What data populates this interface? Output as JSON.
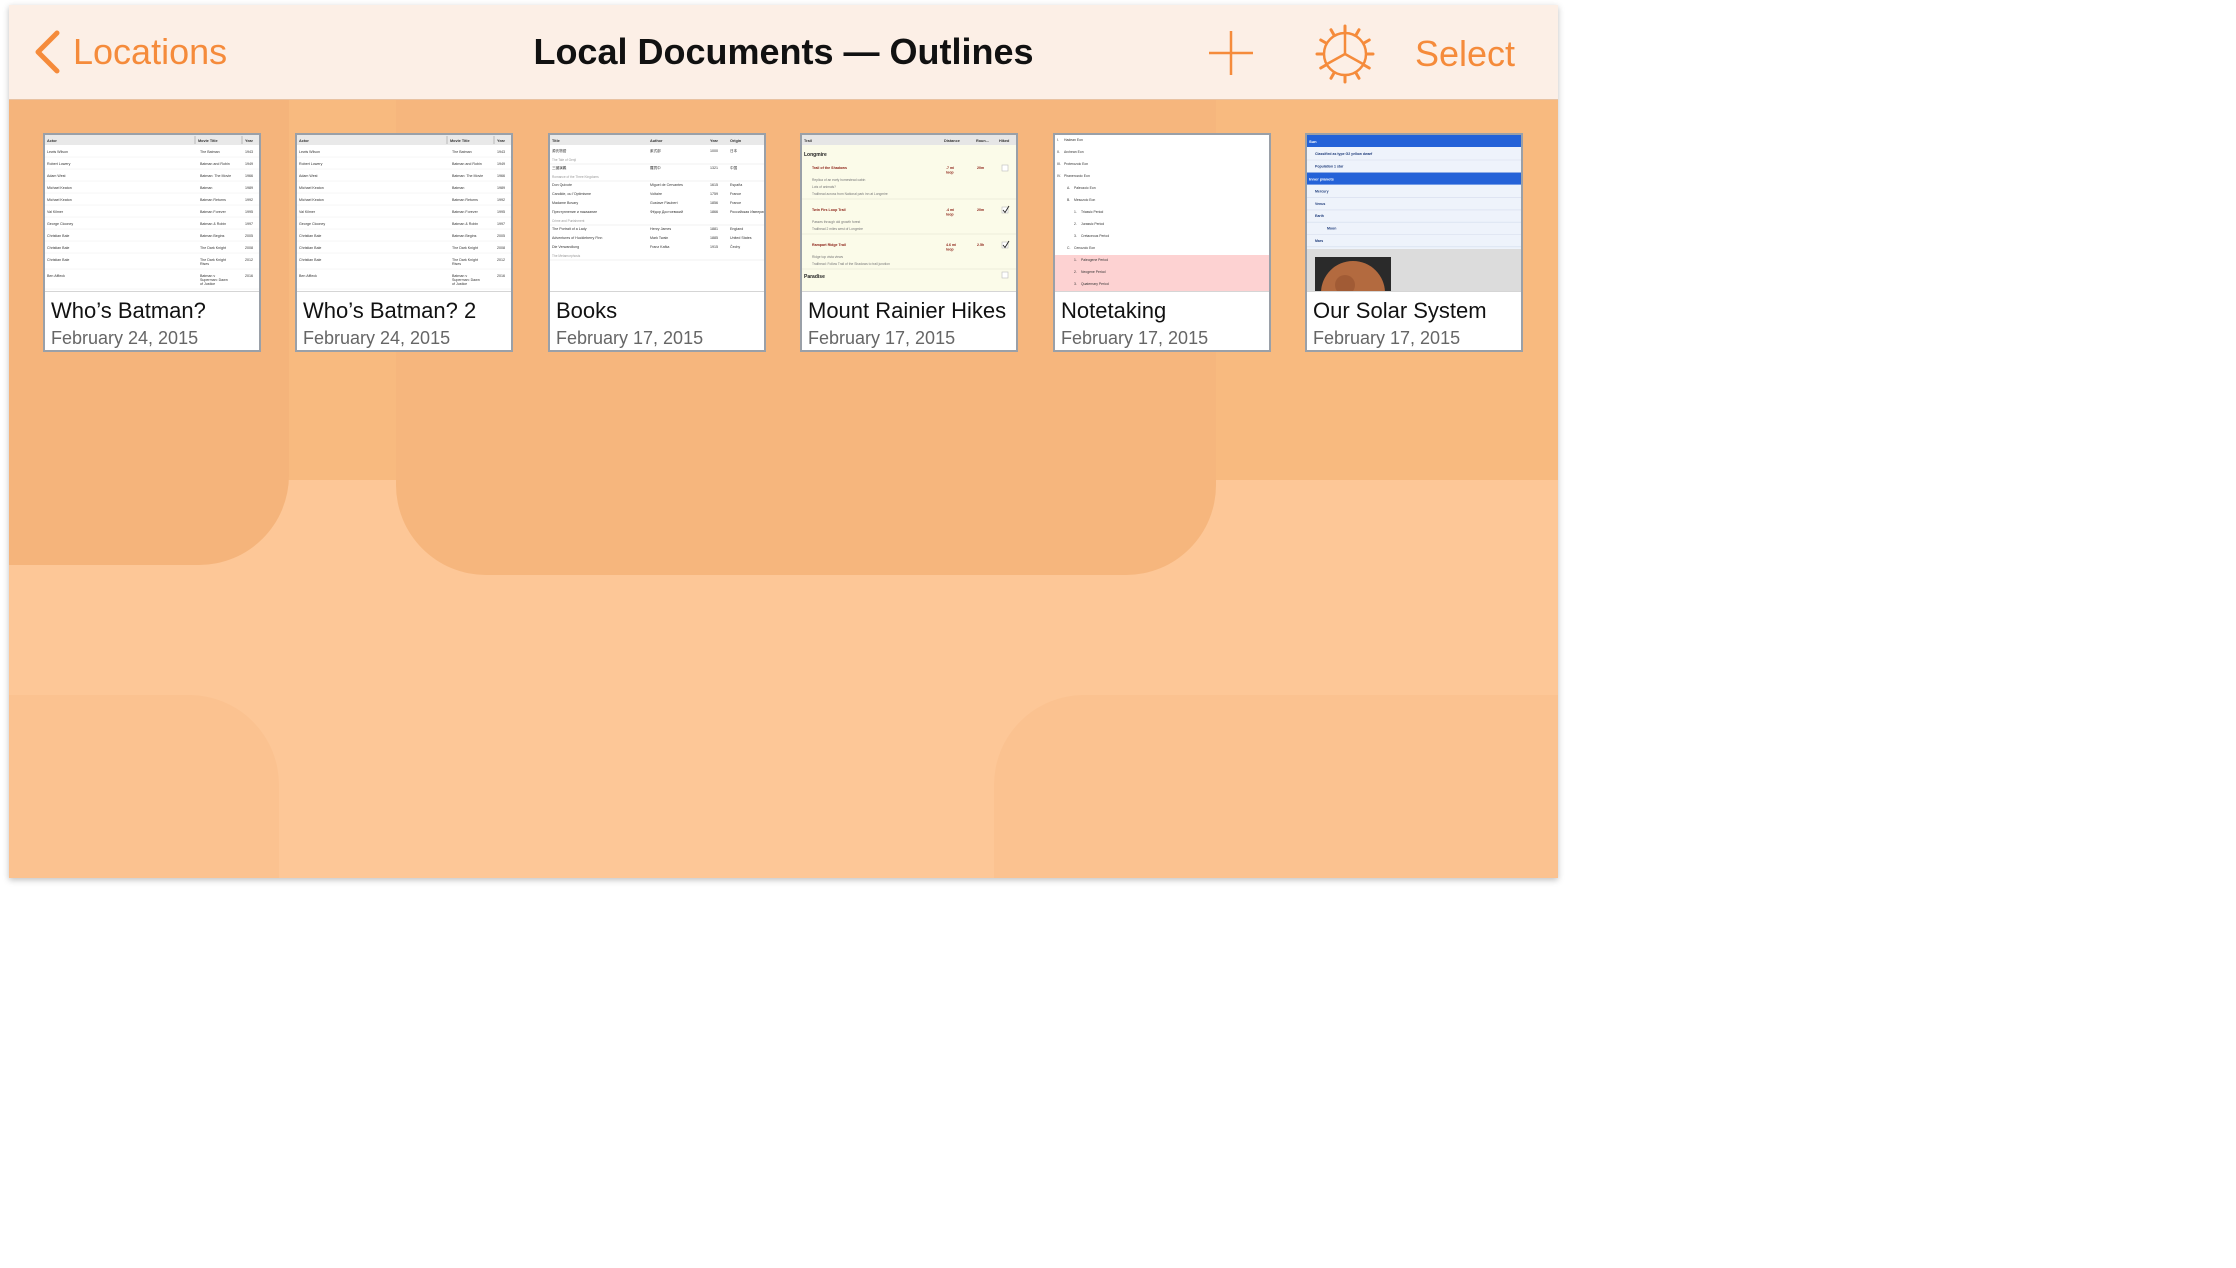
{
  "navbar": {
    "back_label": "Locations",
    "title": "Local Documents — Outlines",
    "select_label": "Select",
    "add_icon": "plus-icon",
    "settings_icon": "gear-icon",
    "accent_color": "#f58b3b"
  },
  "documents": [
    {
      "title": "Who’s Batman?",
      "date": "February 24, 2015",
      "preview": {
        "headers": [
          "Actor",
          "Movie Title",
          "Year"
        ],
        "rows": [
          [
            "Lewis Wilson",
            "The Batman",
            "1943"
          ],
          [
            "Robert Lowery",
            "Batman and Robin",
            "1949"
          ],
          [
            "Adam West",
            "Batman: The Movie",
            "1966"
          ],
          [
            "Michael Keaton",
            "Batman",
            "1989"
          ],
          [
            "Michael Keaton",
            "Batman Returns",
            "1992"
          ],
          [
            "Val Kilmer",
            "Batman Forever",
            "1995"
          ],
          [
            "George Clooney",
            "Batman & Robin",
            "1997"
          ],
          [
            "Christian Bale",
            "Batman Begins",
            "2005"
          ],
          [
            "Christian Bale",
            "The Dark Knight",
            "2008"
          ],
          [
            "Christian Bale",
            "The Dark Knight Rises",
            "2012"
          ],
          [
            "Ben Affleck",
            "Batman v Superman: Dawn of Justice",
            "2016"
          ]
        ]
      }
    },
    {
      "title": "Who’s Batman? 2",
      "date": "February 24, 2015",
      "preview": {
        "headers": [
          "Actor",
          "Movie Title",
          "Year"
        ],
        "rows": [
          [
            "Lewis Wilson",
            "The Batman",
            "1943"
          ],
          [
            "Robert Lowery",
            "Batman and Robin",
            "1949"
          ],
          [
            "Adam West",
            "Batman: The Movie",
            "1966"
          ],
          [
            "Michael Keaton",
            "Batman",
            "1989"
          ],
          [
            "Michael Keaton",
            "Batman Returns",
            "1992"
          ],
          [
            "Val Kilmer",
            "Batman Forever",
            "1995"
          ],
          [
            "George Clooney",
            "Batman & Robin",
            "1997"
          ],
          [
            "Christian Bale",
            "Batman Begins",
            "2005"
          ],
          [
            "Christian Bale",
            "The Dark Knight",
            "2008"
          ],
          [
            "Christian Bale",
            "The Dark Knight Rises",
            "2012"
          ],
          [
            "Ben Affleck",
            "Batman v Superman: Dawn of Justice",
            "2016"
          ]
        ]
      }
    },
    {
      "title": "Books",
      "date": "February 17, 2015",
      "preview": {
        "headers": [
          "Title",
          "Author",
          "Year",
          "Origin"
        ],
        "rows": [
          [
            "源氏物語",
            "紫式部",
            "1000",
            "日本"
          ],
          [
            "The Tale of Genji",
            "",
            "",
            ""
          ],
          [
            "三國演義",
            "羅貫中",
            "1321",
            "中国"
          ],
          [
            "Romance of the Three Kingdoms",
            "",
            "",
            ""
          ],
          [
            "Don Quixote",
            "Miguel de Cervantes",
            "1615",
            "España"
          ],
          [
            "Candide, ou l'Optimisme",
            "Voltaire",
            "1759",
            "France"
          ],
          [
            "Madame Bovary",
            "Gustave Flaubert",
            "1856",
            "France"
          ],
          [
            "Преступление и наказание",
            "Фёдор Достоевский",
            "1866",
            "Российская Империя"
          ],
          [
            "Crime and Punishment",
            "",
            "",
            ""
          ],
          [
            "The Portrait of a Lady",
            "Henry James",
            "1881",
            "England"
          ],
          [
            "Adventures of Huckleberry Finn",
            "Mark Twain",
            "1885",
            "United States"
          ],
          [
            "Die Verwandlung",
            "Franz Kafka",
            "1915",
            "Čechy"
          ],
          [
            "The Metamorphosis",
            "",
            "",
            ""
          ]
        ]
      }
    },
    {
      "title": "Mount Rainier Hikes",
      "date": "February 17, 2015",
      "preview": {
        "headers": [
          "Trail",
          "Distance",
          "Roun...",
          "Hiked"
        ],
        "sections": [
          "Longmire",
          "Paradise"
        ],
        "rows": [
          [
            "Trail of the Shadows",
            ".7 mi loop",
            "20m",
            "Replica of an early homestead cabin",
            "Lots of animals?",
            "Trailhead across from National park inn at Longmire"
          ],
          [
            "Twin Firs Loop Trail",
            ".4 mi loop",
            "20m",
            "Passes through old growth forest",
            "Trailhead 2 miles west of Longmire",
            ""
          ],
          [
            "Rampart Ridge Trail",
            "4.6 mi loop",
            "2.5h",
            "Ridge top vista views",
            "Trailhead: Follow Trail of the Shadows to trail junction",
            ""
          ]
        ]
      }
    },
    {
      "title": "Notetaking",
      "date": "February 17, 2015",
      "preview": {
        "items": [
          [
            "I.",
            "Hadean Eon"
          ],
          [
            "II.",
            "Archean Eon"
          ],
          [
            "III.",
            "Proterozoic Eon"
          ],
          [
            "IV.",
            "Phanerozoic Eon"
          ],
          [
            "A.",
            "Paleozoic Eon"
          ],
          [
            "B.",
            "Mesozoic Eon"
          ],
          [
            "1.",
            "Triassic Period"
          ],
          [
            "2.",
            "Jurassic Period"
          ],
          [
            "3.",
            "Cretaceous Period"
          ],
          [
            "C.",
            "Cenozoic Eon"
          ],
          [
            "1.",
            "Paleogene Period"
          ],
          [
            "2.",
            "Neogene Period"
          ],
          [
            "3.",
            "Quaternary Period"
          ]
        ]
      }
    },
    {
      "title": "Our Solar System",
      "date": "February 17, 2015",
      "preview": {
        "items": [
          "Sun",
          "Classified as type G2 yellow dwarf",
          "Population 1 star",
          "Inner planets",
          "Mercury",
          "Venus",
          "Earth",
          "Moon",
          "Mars"
        ]
      }
    }
  ]
}
